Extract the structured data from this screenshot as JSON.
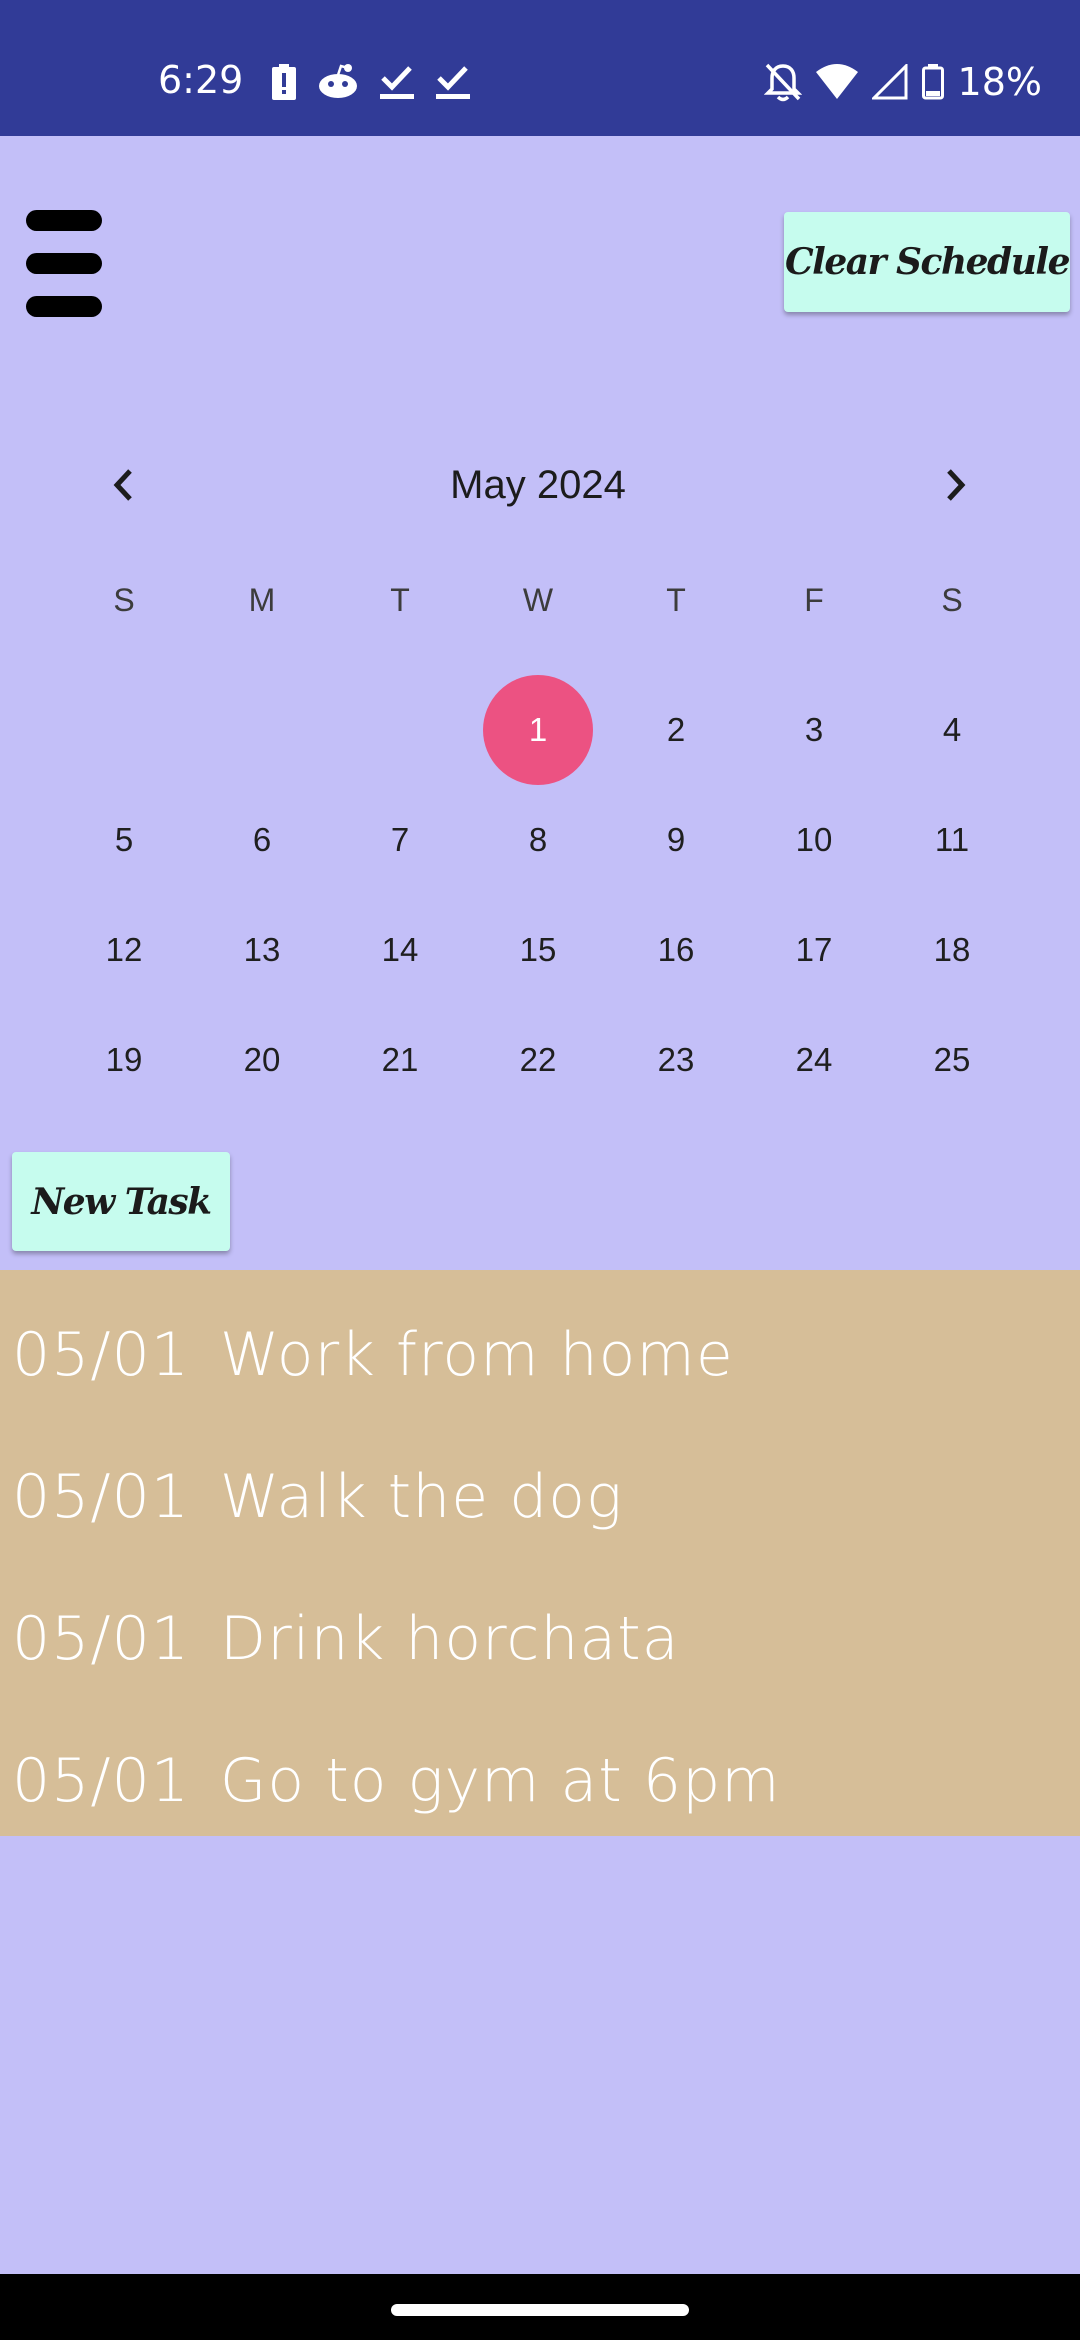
{
  "status_bar": {
    "time": "6:29",
    "left_icons": [
      "battery-alert-icon",
      "reddit-icon",
      "task-done-icon",
      "task-done-icon"
    ],
    "right_icons": [
      "notifications-off-icon",
      "wifi-icon",
      "cellular-signal-icon",
      "battery-icon"
    ],
    "battery_percent": "18%"
  },
  "toolbar": {
    "menu_icon": "hamburger-menu-icon",
    "clear_label": "Clear Schedule"
  },
  "calendar": {
    "month_label": "May 2024",
    "prev_icon": "chevron-left-icon",
    "next_icon": "chevron-right-icon",
    "weekdays": [
      "S",
      "M",
      "T",
      "W",
      "T",
      "F",
      "S"
    ],
    "weeks": [
      [
        "",
        "",
        "",
        "1",
        "2",
        "3",
        "4"
      ],
      [
        "5",
        "6",
        "7",
        "8",
        "9",
        "10",
        "11"
      ],
      [
        "12",
        "13",
        "14",
        "15",
        "16",
        "17",
        "18"
      ],
      [
        "19",
        "20",
        "21",
        "22",
        "23",
        "24",
        "25"
      ]
    ],
    "selected_day": "1",
    "selected_color": "#ec5282"
  },
  "new_task_label": "New Task",
  "tasks": [
    {
      "date": "05/01",
      "text": "Work from home"
    },
    {
      "date": "05/01",
      "text": "Walk the dog"
    },
    {
      "date": "05/01",
      "text": "Drink horchata"
    },
    {
      "date": "05/01",
      "text": "Go to gym at 6pm"
    }
  ],
  "colors": {
    "status_bar": "#313b97",
    "background": "#c3bff8",
    "button": "#c6fcee",
    "task_list": "#d6be98"
  }
}
